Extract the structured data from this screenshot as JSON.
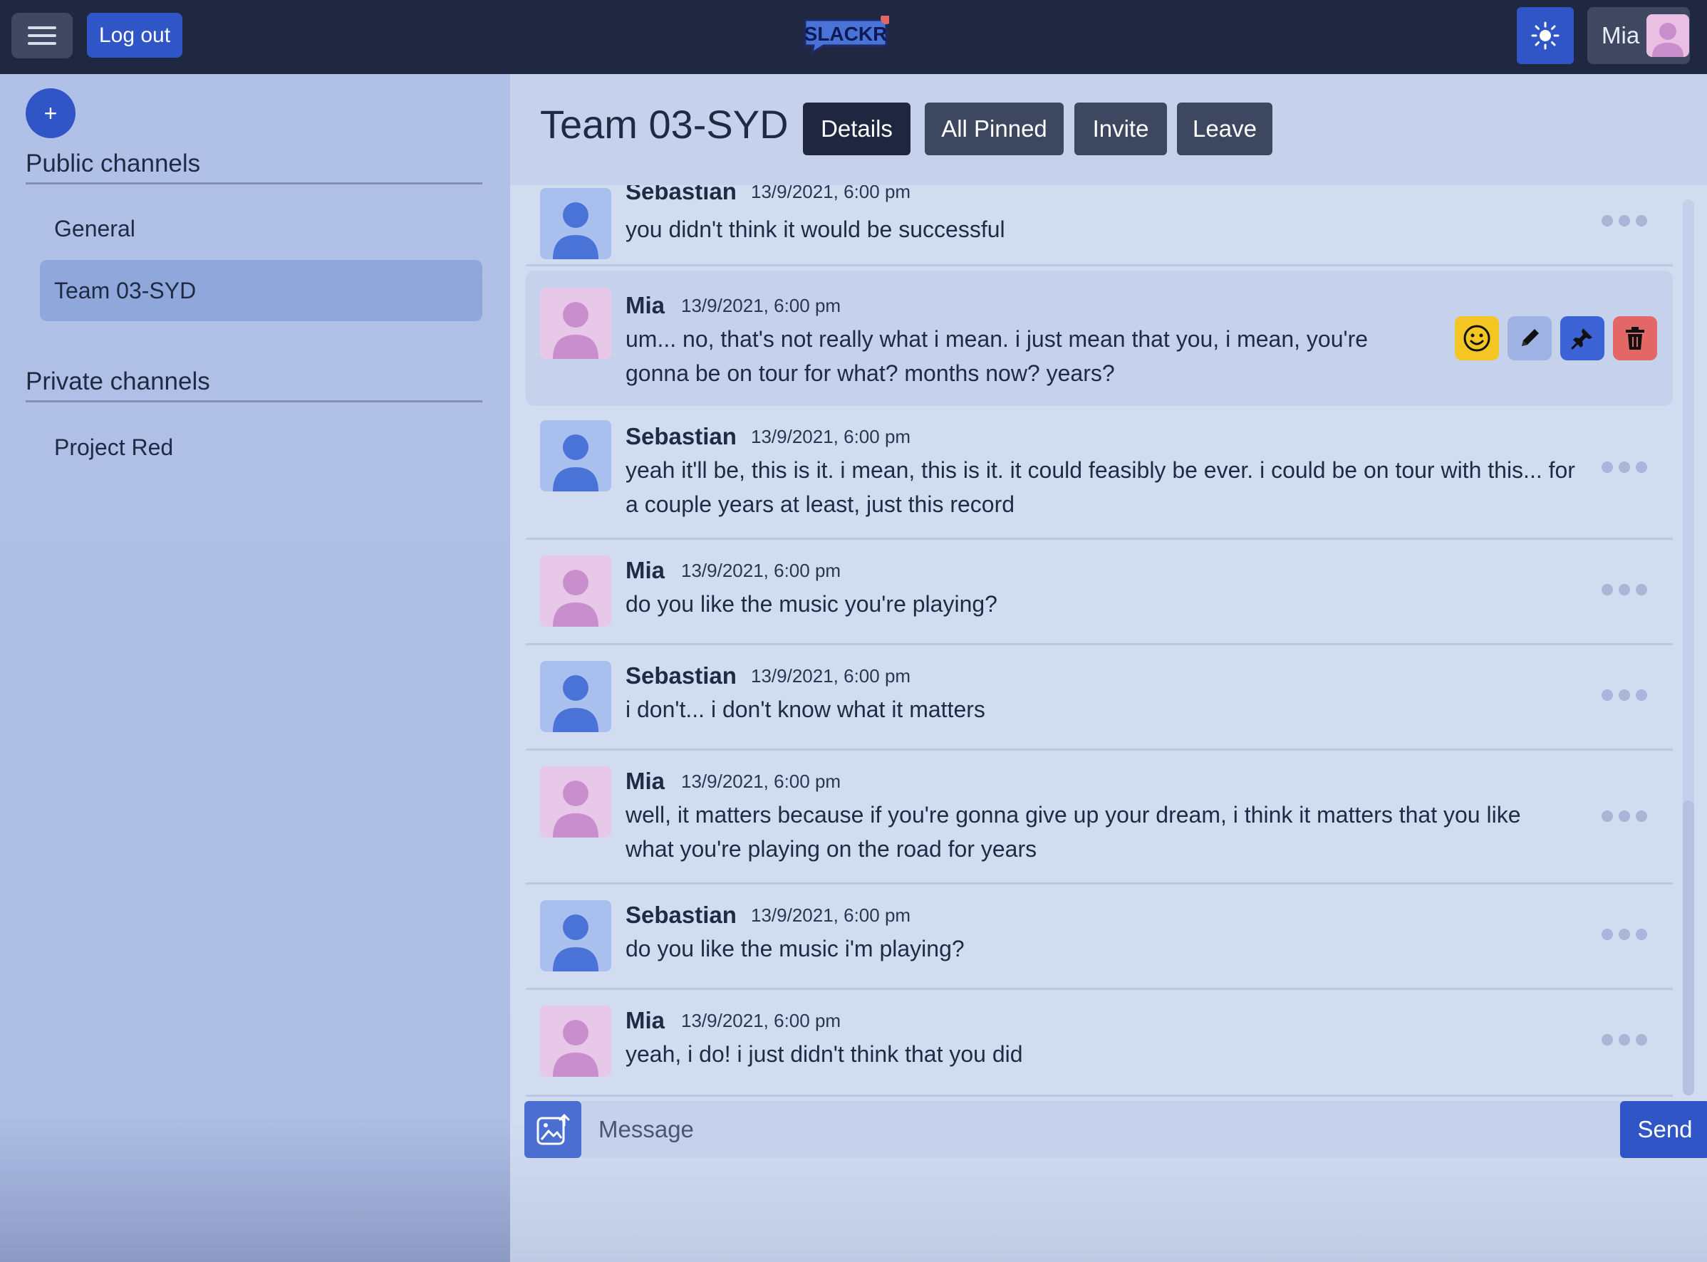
{
  "header": {
    "logout_label": "Log out",
    "logo_text": "SLACKR",
    "user_name": "Mia"
  },
  "sidebar": {
    "public_title": "Public channels",
    "public_channels": [
      {
        "label": "General",
        "active": false
      },
      {
        "label": "Team 03-SYD",
        "active": true
      }
    ],
    "private_title": "Private channels",
    "private_channels": [
      {
        "label": "Project Red",
        "active": false
      }
    ],
    "add_label": "+"
  },
  "channel": {
    "title": "Team 03-SYD",
    "buttons": {
      "details": "Details",
      "all_pinned": "All Pinned",
      "invite": "Invite",
      "leave": "Leave"
    }
  },
  "messages": [
    {
      "author": "Sebastian",
      "time": "13/9/2021, 6:00 pm",
      "text": "you didn't think it would be successful"
    },
    {
      "author": "Mia",
      "time": "13/9/2021, 6:00 pm",
      "text": "um... no, that's not really what i mean. i just mean that you, i mean, you're gonna be on tour for what? months now? years?"
    },
    {
      "author": "Sebastian",
      "time": "13/9/2021, 6:00 pm",
      "text": "yeah it'll be, this is it. i mean, this is it. it could feasibly be ever. i could be on tour with this... for a couple years at least, just this record"
    },
    {
      "author": "Mia",
      "time": "13/9/2021, 6:00 pm",
      "text": "do you like the music you're playing?"
    },
    {
      "author": "Sebastian",
      "time": "13/9/2021, 6:00 pm",
      "text": "i don't... i don't know what it matters"
    },
    {
      "author": "Mia",
      "time": "13/9/2021, 6:00 pm",
      "text": "well, it matters because if you're gonna give up your dream, i think it matters that you like what you're playing on the road for years"
    },
    {
      "author": "Sebastian",
      "time": "13/9/2021, 6:00 pm",
      "text": "do you like the music i'm playing?"
    },
    {
      "author": "Mia",
      "time": "13/9/2021, 6:00 pm",
      "text": "yeah, i do! i just didn't think that you did"
    }
  ],
  "composer": {
    "placeholder": "Message",
    "value": "",
    "send_label": "Send"
  },
  "colors": {
    "header_bg": "#202741",
    "accent": "#2f55c7",
    "sidebar_bg": "#b0c0e7",
    "active_channel": "#8fa7da",
    "react_button": "#f3c623",
    "edit_button": "#9eb3e4",
    "pin_button": "#3b63d6",
    "delete_button": "#e36767"
  },
  "icons": {
    "menu": "hamburger-icon",
    "theme": "sun-icon",
    "react": "smiley-icon",
    "edit": "pencil-icon",
    "pin": "pin-icon",
    "delete": "trash-icon",
    "more": "ellipsis-icon",
    "upload": "image-upload-icon"
  }
}
